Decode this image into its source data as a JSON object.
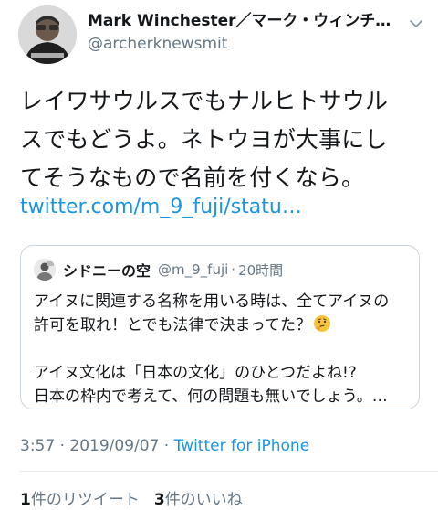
{
  "author": {
    "display_name": "Mark Winchester／マーク・ウィンチェ…",
    "handle": "@archerknewsmit"
  },
  "tweet": {
    "text_lines": [
      "レイワサウルスでもナルヒトサウル",
      "スでもどうよ。ネトウヨが大事にし",
      "てそうなもので名前を付くなら。"
    ],
    "link": "twitter.com/m_9_fuji/statu…"
  },
  "quote": {
    "name": "シドニーの空",
    "handle": "@m_9_fuji",
    "separator": "·",
    "time": "20時間",
    "lines": [
      "アイヌに関連する名称を用いる時は、全てアイヌの",
      "許可を取れ！とでも法律で決まってた？",
      "アイヌ文化は「日本の文化」のひとつだよね!?",
      "日本の枠内で考えて、何の問題も無いでしょう。…"
    ]
  },
  "meta": {
    "time": "3:57",
    "sep1": " · ",
    "date": "2019/09/07",
    "sep2": " · ",
    "source": "Twitter for iPhone"
  },
  "stats": {
    "retweets_count": "1",
    "retweets_label": "件のリツイート",
    "likes_count": "3",
    "likes_label": "件のいいね"
  },
  "colors": {
    "link": "#1b95e0",
    "muted": "#657786",
    "border": "#ccd6dd"
  },
  "icons": {
    "chevron": "chevron-down-icon",
    "emoji": "thinking-face-emoji"
  }
}
